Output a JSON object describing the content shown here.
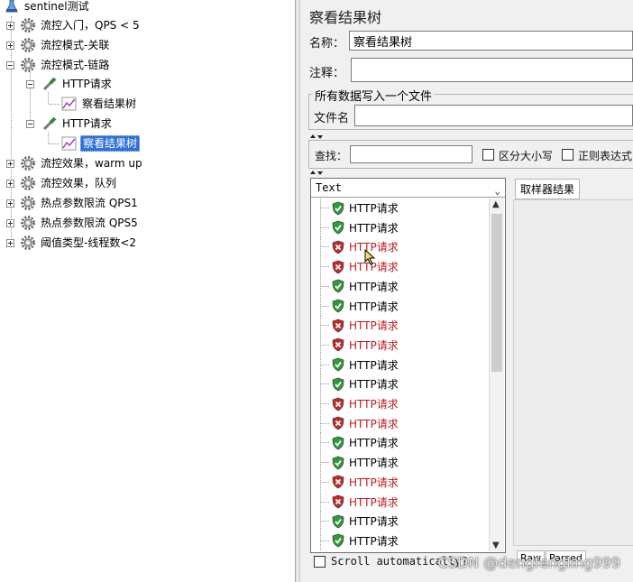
{
  "tree": {
    "root": "sentinel测试",
    "items": [
      {
        "label": "流控入门，QPS < 5"
      },
      {
        "label": "流控模式-关联"
      },
      {
        "label": "流控模式-链路"
      },
      {
        "label": "HTTP请求"
      },
      {
        "label": "察看结果树"
      },
      {
        "label": "HTTP请求"
      },
      {
        "label": "察看结果树"
      },
      {
        "label": "流控效果，warm up"
      },
      {
        "label": "流控效果，队列"
      },
      {
        "label": "热点参数限流 QPS1"
      },
      {
        "label": "热点参数限流 QPS5"
      },
      {
        "label": "阈值类型-线程数<2"
      }
    ]
  },
  "panel": {
    "title": "察看结果树",
    "name_label": "名称：",
    "name_value": "察看结果树",
    "comment_label": "注释：",
    "comment_value": "",
    "file_group_title": "所有数据写入一个文件",
    "filename_label": "文件名",
    "filename_value": "",
    "search_label": "查找：",
    "search_value": "",
    "case_label": "区分大小写",
    "regex_label": "正则表达式",
    "renderer": "Text",
    "sampler_tab": "取样器结果",
    "scroll_label": "Scroll automatically?",
    "raw_tab": "Raw",
    "parsed_tab": "Parsed"
  },
  "results": [
    {
      "label": "HTTP请求",
      "status": "success"
    },
    {
      "label": "HTTP请求",
      "status": "success"
    },
    {
      "label": "HTTP请求",
      "status": "fail"
    },
    {
      "label": "HTTP请求",
      "status": "fail"
    },
    {
      "label": "HTTP请求",
      "status": "success"
    },
    {
      "label": "HTTP请求",
      "status": "success"
    },
    {
      "label": "HTTP请求",
      "status": "fail"
    },
    {
      "label": "HTTP请求",
      "status": "fail"
    },
    {
      "label": "HTTP请求",
      "status": "success"
    },
    {
      "label": "HTTP请求",
      "status": "success"
    },
    {
      "label": "HTTP请求",
      "status": "fail"
    },
    {
      "label": "HTTP请求",
      "status": "fail"
    },
    {
      "label": "HTTP请求",
      "status": "success"
    },
    {
      "label": "HTTP请求",
      "status": "success"
    },
    {
      "label": "HTTP请求",
      "status": "fail"
    },
    {
      "label": "HTTP请求",
      "status": "fail"
    },
    {
      "label": "HTTP请求",
      "status": "success"
    },
    {
      "label": "HTTP请求",
      "status": "success"
    }
  ],
  "colors": {
    "success": "#2e9b3a",
    "fail": "#c62828",
    "selection": "#2f6fd6"
  },
  "watermark": "CSDN @dengfengling999"
}
